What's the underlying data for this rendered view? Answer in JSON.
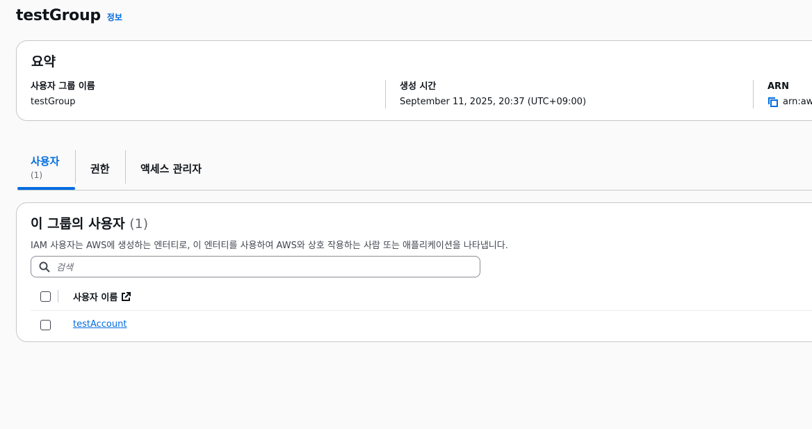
{
  "page": {
    "title": "testGroup",
    "info_link": "정보"
  },
  "summary": {
    "heading": "요약",
    "group_name_label": "사용자 그룹 이름",
    "group_name_value": "testGroup",
    "created_label": "생성 시간",
    "created_value": "September 11, 2025, 20:37 (UTC+09:00)",
    "arn_label": "ARN",
    "arn_value": "arn:aws"
  },
  "tabs": [
    {
      "label": "사용자",
      "count": "(1)",
      "active": true
    },
    {
      "label": "권한"
    },
    {
      "label": "액세스 관리자"
    }
  ],
  "users_panel": {
    "heading": "이 그룹의 사용자",
    "count": "(1)",
    "description": "IAM 사용자는 AWS에 생성하는 엔터티로, 이 엔터티를 사용하여 AWS와 상호 작용하는 사람 또는 애플리케이션을 나타냅니다.",
    "search_placeholder": "검색",
    "column_header": "사용자 이름",
    "rows": [
      {
        "username": "testAccount"
      }
    ]
  },
  "colors": {
    "accent": "#006ce0",
    "border": "#c6c6cd",
    "background": "#fafafa"
  },
  "icons": {
    "copy": "copy-icon",
    "search": "search-icon",
    "external": "external-link-icon"
  }
}
